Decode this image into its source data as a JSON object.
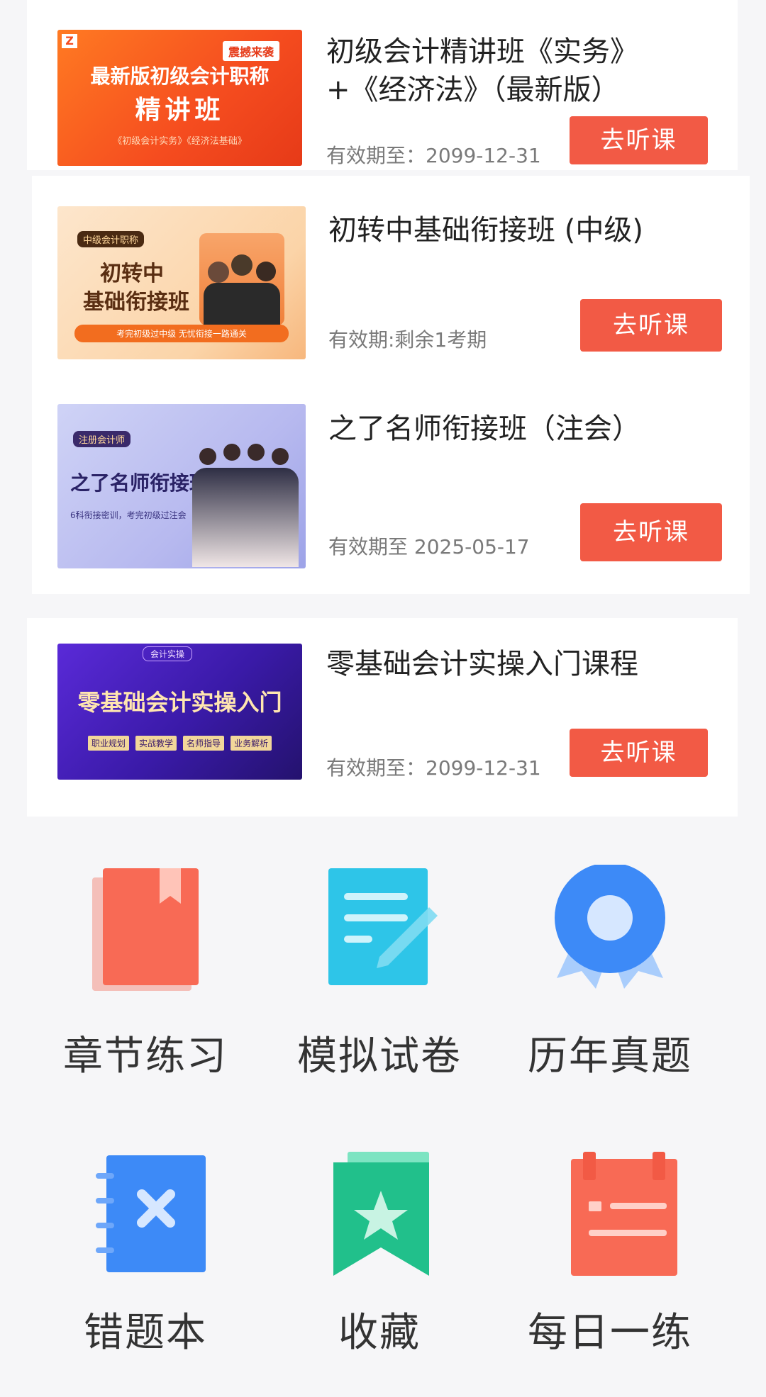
{
  "courses": [
    {
      "title": "初级会计精讲班《实务》+《经济法》（最新版）",
      "validity": "有效期至：2099-12-31",
      "button": "去听课",
      "thumb": {
        "badge": "震撼来袭",
        "line1": "最新版初级会计职称",
        "line2": "精讲班",
        "sub": "《初级会计实务》《经济法基础》"
      }
    },
    {
      "title": "初转中基础衔接班 (中级)",
      "validity": "有效期:剩余1考期",
      "button": "去听课",
      "thumb": {
        "badge": "中级会计职称",
        "line1": "初转中",
        "line2": "基础衔接班",
        "sub": "考完初级过中级 无忧衔接一路通关"
      }
    },
    {
      "title": "之了名师衔接班（注会）",
      "validity": "有效期至 2025-05-17",
      "button": "去听课",
      "thumb": {
        "badge": "注册会计师",
        "line1": "之了名师衔接班",
        "sub": "6科衔接密训，考完初级过注会"
      }
    },
    {
      "title": "零基础会计实操入门课程",
      "validity": "有效期至：2099-12-31",
      "button": "去听课",
      "thumb": {
        "badge": "会计实操",
        "line1": "零基础会计实操入门",
        "tags": [
          "职业规划",
          "实战教学",
          "名师指导",
          "业务解析"
        ]
      }
    }
  ],
  "grid": [
    {
      "label": "章节练习",
      "icon": "bookmark-book-icon",
      "color": "#f25a45"
    },
    {
      "label": "模拟试卷",
      "icon": "document-pen-icon",
      "color": "#2ec5e8"
    },
    {
      "label": "历年真题",
      "icon": "medal-icon",
      "color": "#3d8af7"
    },
    {
      "label": "错题本",
      "icon": "error-book-icon",
      "color": "#3d8af7"
    },
    {
      "label": "收藏",
      "icon": "star-bookmark-icon",
      "color": "#21c08b"
    },
    {
      "label": "每日一练",
      "icon": "calendar-icon",
      "color": "#f25a45"
    }
  ],
  "colors": {
    "accent": "#f25a45",
    "text": "#222222",
    "muted": "#7a7a7a",
    "background": "#f6f6f8"
  }
}
